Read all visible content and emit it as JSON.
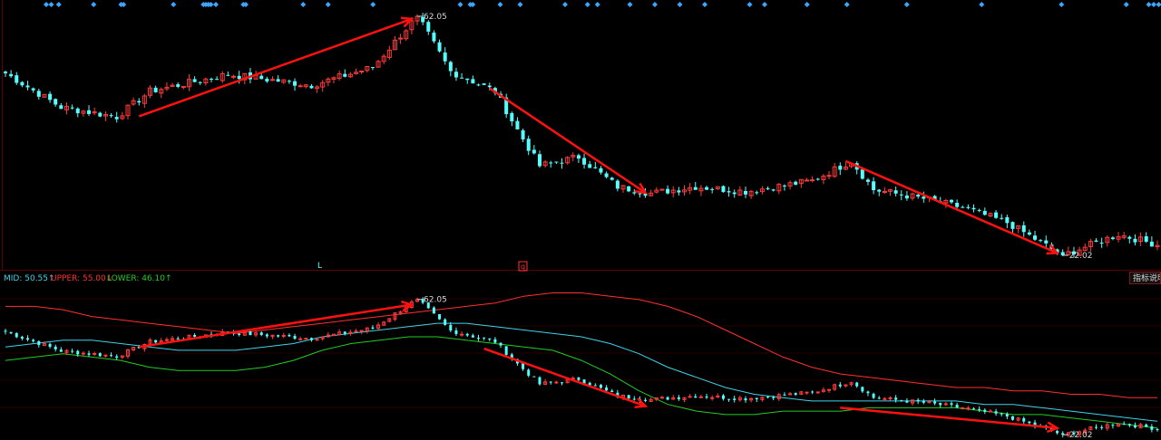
{
  "chart_data": {
    "type": "candlestick",
    "price_high_label": "62.05",
    "price_low_label": "22.02",
    "ymax": 62.05,
    "ymin": 22.02,
    "markers": {
      "left": "L",
      "right": "q"
    },
    "indicator": {
      "name_text": "MID:",
      "mid": {
        "label": "MID: 50.55↑",
        "value": 50.55
      },
      "upper": {
        "label": "UPPER: 55.00↓",
        "value": 55.0
      },
      "lower": {
        "label": "LOWER: 46.10↑",
        "value": 46.1
      }
    },
    "anchors": [
      {
        "i": 0,
        "v": 52.5
      },
      {
        "i": 10,
        "v": 46.8
      },
      {
        "i": 20,
        "v": 45.2
      },
      {
        "i": 26,
        "v": 49.5
      },
      {
        "i": 40,
        "v": 52.3
      },
      {
        "i": 55,
        "v": 50.5
      },
      {
        "i": 66,
        "v": 53.5
      },
      {
        "i": 74,
        "v": 62.05
      },
      {
        "i": 80,
        "v": 52.8
      },
      {
        "i": 88,
        "v": 49.5
      },
      {
        "i": 92,
        "v": 43.0
      },
      {
        "i": 96,
        "v": 37.0
      },
      {
        "i": 103,
        "v": 38.5
      },
      {
        "i": 110,
        "v": 33.5
      },
      {
        "i": 116,
        "v": 32.4
      },
      {
        "i": 124,
        "v": 33.5
      },
      {
        "i": 133,
        "v": 32.7
      },
      {
        "i": 145,
        "v": 34.5
      },
      {
        "i": 152,
        "v": 37.8
      },
      {
        "i": 156,
        "v": 33.0
      },
      {
        "i": 165,
        "v": 31.5
      },
      {
        "i": 172,
        "v": 30.0
      },
      {
        "i": 180,
        "v": 27.5
      },
      {
        "i": 190,
        "v": 22.02
      },
      {
        "i": 200,
        "v": 25.5
      },
      {
        "i": 207,
        "v": 23.8
      }
    ],
    "candle_count": 208,
    "upper_band": [
      60,
      60,
      59,
      57,
      56,
      55,
      54,
      53,
      52,
      53,
      54,
      55,
      56,
      57,
      58,
      59,
      60,
      61,
      63,
      64,
      64,
      63,
      62,
      60,
      57,
      53,
      49,
      45,
      42,
      40,
      39,
      38,
      37,
      36,
      36,
      35,
      35,
      34,
      34,
      33,
      33
    ],
    "lower_band": [
      44,
      45,
      46,
      45,
      44,
      42,
      41,
      41,
      41,
      42,
      44,
      47,
      49,
      50,
      51,
      51,
      50,
      49,
      48,
      47,
      44,
      40,
      35,
      31,
      29,
      28,
      28,
      29,
      29,
      29,
      30,
      30,
      30,
      30,
      29,
      28,
      28,
      27,
      26,
      25,
      24
    ],
    "mid_band": [
      48,
      49,
      50,
      50,
      49,
      48,
      47,
      47,
      47,
      48,
      49,
      51,
      52,
      53,
      54,
      55,
      55,
      54,
      53,
      52,
      51,
      49,
      46,
      42,
      39,
      36,
      34,
      33,
      32,
      32,
      32,
      32,
      32,
      32,
      31,
      31,
      30,
      29,
      28,
      27,
      26
    ],
    "colors": {
      "up": "#ff3a3a",
      "down": "#54ffff",
      "arrow": "#ff1111",
      "mid": "#3fd3e8",
      "upper": "#ff3030",
      "lower": "#22cc22",
      "grid": "#5a0000",
      "text": "#d8d8d8",
      "diamond": "#3aa6ff"
    },
    "diamond_positions": [
      4,
      6,
      9,
      23,
      34,
      35,
      55,
      67,
      68,
      69,
      70,
      72,
      83,
      84,
      107,
      117,
      135,
      170,
      174,
      175,
      186,
      194,
      212,
      221,
      225,
      238,
      248,
      258,
      268,
      286,
      292,
      309,
      325,
      349,
      379,
      411,
      437,
      446,
      448,
      450
    ],
    "up_arrows": [
      [
        0,
        30,
        0.14,
        0.29
      ],
      [
        1,
        0.07,
        0.35,
        0.16,
        0.6
      ]
    ]
  },
  "ui": {
    "help_button": "指标说明"
  }
}
